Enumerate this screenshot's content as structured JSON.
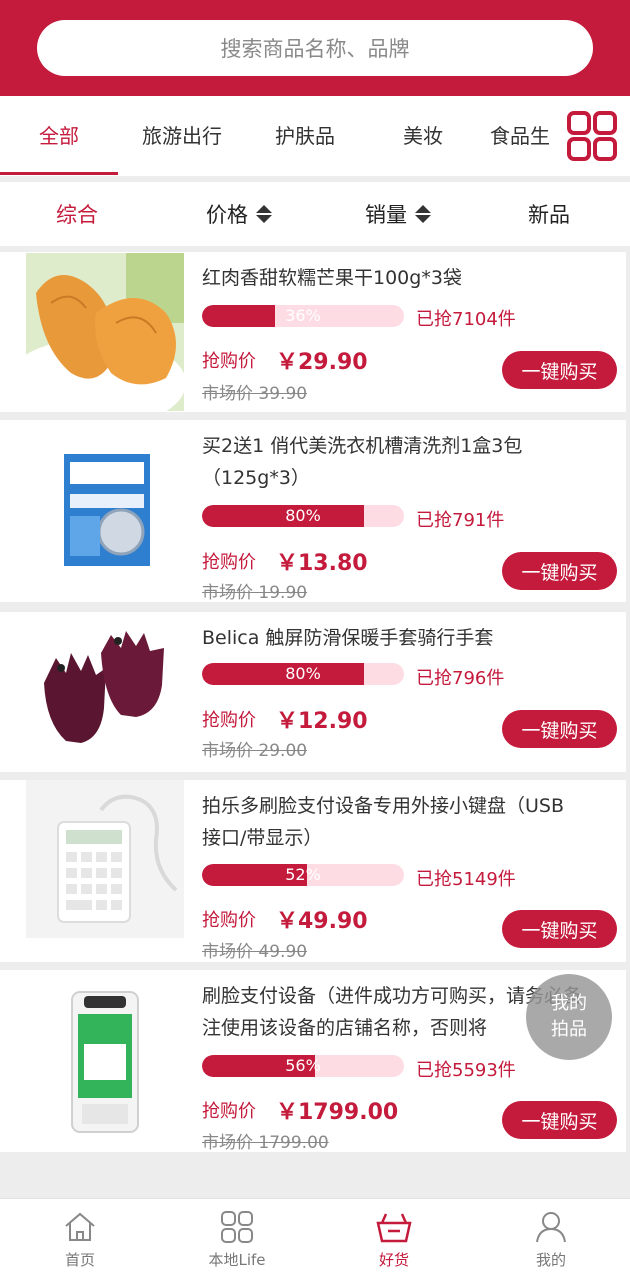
{
  "search": {
    "placeholder": "搜索商品名称、品牌"
  },
  "categories": [
    {
      "label": "全部",
      "active": true
    },
    {
      "label": "旅游出行",
      "active": false
    },
    {
      "label": "护肤品",
      "active": false
    },
    {
      "label": "美妆",
      "active": false
    },
    {
      "label": "食品生",
      "active": false
    }
  ],
  "sort": [
    {
      "label": "综合",
      "active": true
    },
    {
      "label": "价格"
    },
    {
      "label": "销量"
    },
    {
      "label": "新品"
    }
  ],
  "products": [
    {
      "name": "红肉香甜软糯芒果干100g*3袋",
      "progress_label": "36%",
      "progress": 0.36,
      "sold": "已抢7104件",
      "price_label": "抢购价",
      "price": "￥29.90",
      "market": "市场价  39.90",
      "buy": "一键购买"
    },
    {
      "name": "买2送1 俏代美洗衣机槽清洗剂1盒3包（125g*3）",
      "progress_label": "80%",
      "progress": 0.8,
      "sold": "已抢791件",
      "price_label": "抢购价",
      "price": "￥13.80",
      "market": "市场价  19.90",
      "buy": "一键购买"
    },
    {
      "name": "Belica 触屏防滑保暖手套骑行手套",
      "progress_label": "80%",
      "progress": 0.8,
      "sold": "已抢796件",
      "price_label": "抢购价",
      "price": "￥12.90",
      "market": "市场价  29.00",
      "buy": "一键购买"
    },
    {
      "name": "拍乐多刷脸支付设备专用外接小键盘（USB接口/带显示）",
      "progress_label": "52%",
      "progress": 0.52,
      "sold": "已抢5149件",
      "price_label": "抢购价",
      "price": "￥49.90",
      "market": "市场价  49.90",
      "buy": "一键购买"
    },
    {
      "name": "刷脸支付设备（进件成功方可购买，请务必备注使用该设备的店铺名称，否则将",
      "progress_label": "56%",
      "progress": 0.56,
      "sold": "已抢5593件",
      "price_label": "抢购价",
      "price": "￥1799.00",
      "market": "市场价  1799.00",
      "buy": "一键购买"
    }
  ],
  "float_button": {
    "line1": "我的",
    "line2": "拍品"
  },
  "tabs": [
    {
      "label": "首页",
      "icon": "home-icon"
    },
    {
      "label": "本地Life",
      "icon": "grid-icon"
    },
    {
      "label": "好货",
      "icon": "basket-icon",
      "active": true
    },
    {
      "label": "我的",
      "icon": "user-icon"
    }
  ],
  "colors": {
    "brand": "#c41a3b",
    "bar_bg": "#fddde3"
  }
}
